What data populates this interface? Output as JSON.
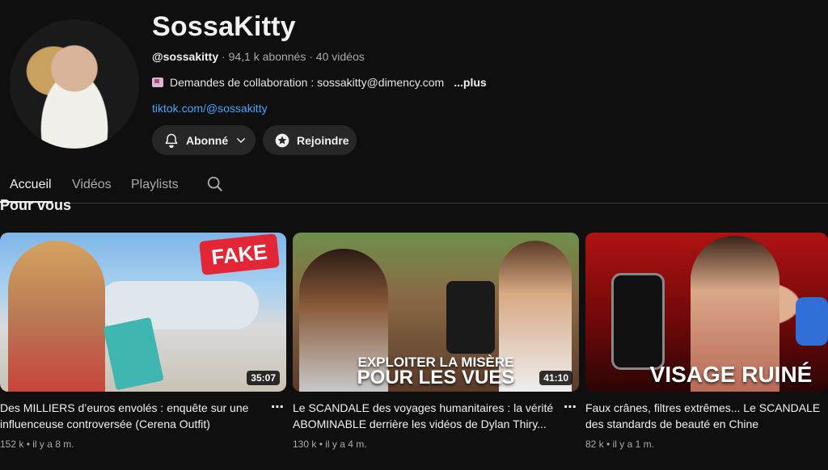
{
  "channel": {
    "name": "SossaKitty",
    "handle": "@sossakitty",
    "subscribers": "94,1 k abonnés",
    "videos_count": "40 vidéos",
    "description": "Demandes de collaboration : sossakitty@dimency.com",
    "more": "...plus",
    "link": "tiktok.com/@sossakitty"
  },
  "buttons": {
    "subscribed": "Abonné",
    "join": "Rejoindre"
  },
  "tabs": [
    "Accueil",
    "Vidéos",
    "Playlists"
  ],
  "section_title": "Pour vous",
  "videos": [
    {
      "title": "Des MILLIERS d’euros envolés : enquête sur une influenceuse controversée (Cerena Outfit)",
      "views": "152 k",
      "age": "il y a 8 m.",
      "duration": "35:07",
      "thumb_tag": "FAKE",
      "thumb_text": ""
    },
    {
      "title": "Le SCANDALE des voyages humanitaires : la vérité ABOMINABLE derrière les vidéos de Dylan Thiry...",
      "views": "130 k",
      "age": "il y a 4 m.",
      "duration": "41:10",
      "thumb_tag": "",
      "thumb_text_1": "EXPLOITER LA MISÈRE",
      "thumb_text_2": "POUR LES VUES"
    },
    {
      "title": "Faux crânes, filtres extrêmes... Le SCANDALE des standards de beauté en Chine",
      "views": "82 k",
      "age": "il y a 1 m.",
      "duration": "",
      "thumb_tag": "",
      "thumb_text_1": "VISAGE RUINÉ"
    }
  ],
  "icons": {
    "bell": "bell-icon",
    "chevron": "chevron-down-icon",
    "join": "star-badge-icon",
    "search": "search-icon",
    "mail": "mail-icon",
    "more": "more-vert-icon"
  }
}
